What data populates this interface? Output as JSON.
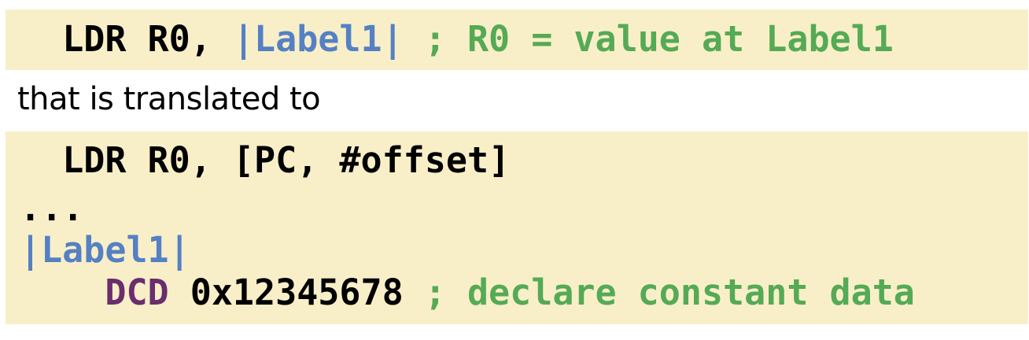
{
  "block1": {
    "line1": {
      "indent": "  ",
      "instruction": "LDR R0, ",
      "label": "|Label1|",
      "comment": " ; R0 = value at Label1"
    }
  },
  "prose": {
    "text": "that is translated to"
  },
  "block2": {
    "line1": {
      "indent": "  ",
      "instruction": "LDR R0, [PC, #offset]"
    },
    "line2": {
      "text": "..."
    },
    "line3": {
      "label": "|Label1|"
    },
    "line4": {
      "indent": "    ",
      "directive": "DCD",
      "value": " 0x12345678",
      "comment": " ; declare constant data"
    }
  }
}
